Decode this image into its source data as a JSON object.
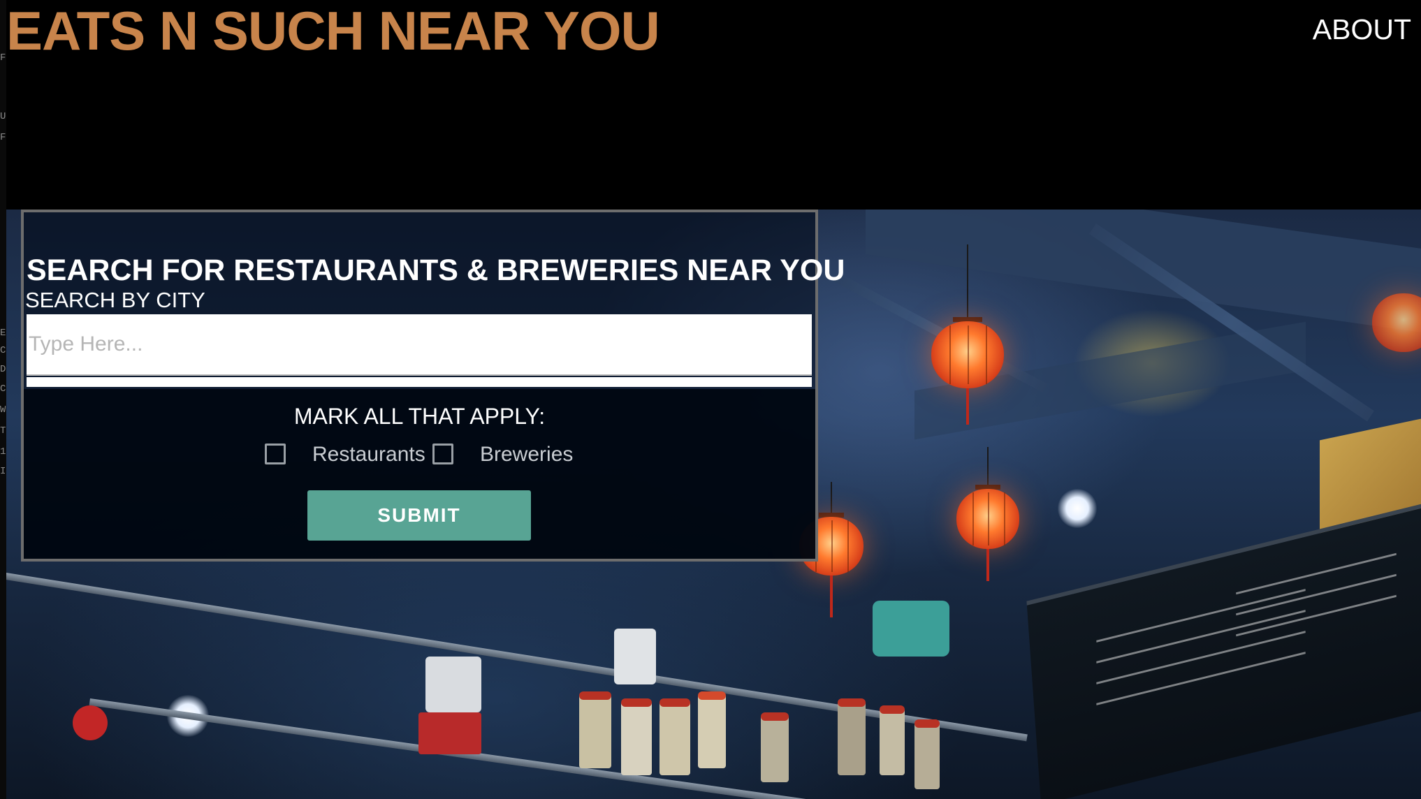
{
  "header": {
    "brand": "EATS N SUCH NEAR YOU",
    "about_label": "ABOUT",
    "brand_color": "#c8844b"
  },
  "search": {
    "title": "SEARCH FOR RESTAURANTS & BREWERIES NEAR YOU",
    "subtitle": "SEARCH BY CITY",
    "placeholder": "Type Here...",
    "value": "",
    "mark_label": "MARK ALL THAT APPLY:",
    "options": [
      {
        "label": "Restaurants",
        "checked": false
      },
      {
        "label": "Breweries",
        "checked": false
      }
    ],
    "submit_label": "SUBMIT",
    "submit_color": "#58a494"
  },
  "side_strip": {
    "chars": [
      "F",
      "U",
      "F",
      "E",
      "C",
      "D",
      "C",
      "W",
      "T",
      "1",
      "I"
    ]
  }
}
